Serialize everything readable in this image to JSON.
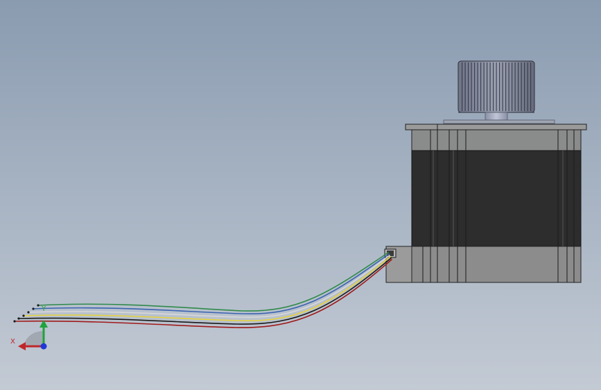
{
  "viewport": {
    "background_top": "#8a9bb0",
    "background_bottom": "#c3cad4"
  },
  "triad": {
    "x_label": "X",
    "y_label": "Y",
    "x_color": "#c0262a",
    "y_color": "#1fa33a",
    "z_color": "#2038d8"
  },
  "model": {
    "parts": [
      "gear-pulley",
      "shaft",
      "motor-body",
      "connector",
      "wire-bundle"
    ],
    "wire_colors": [
      "#2e8a4a",
      "#3a63b0",
      "#d8d8d8",
      "#e6d23c",
      "#1a1a1a",
      "#a01a1a"
    ]
  }
}
